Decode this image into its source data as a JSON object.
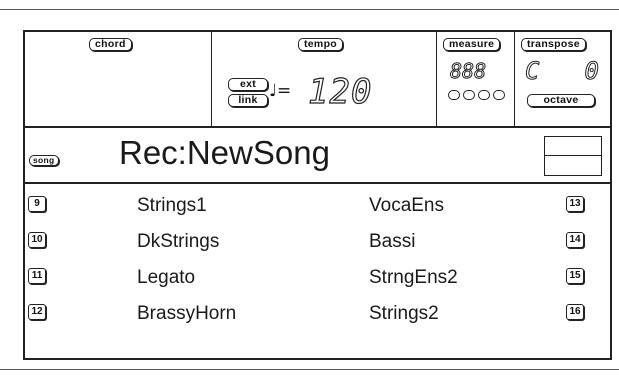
{
  "header": {
    "chord_label": "chord",
    "tempo_label": "tempo",
    "ext_label": "ext",
    "link_label": "link",
    "note_symbol": "♩=",
    "tempo_value": "120",
    "measure_label": "measure",
    "measure_value": "888",
    "transpose_label": "transpose",
    "transpose_left": "C",
    "transpose_right": "0",
    "octave_label": "octave"
  },
  "title": {
    "mode_label": "song",
    "text": "Rec:NewSong"
  },
  "tracks": [
    {
      "left_num": "9",
      "left_name": "Strings1",
      "right_name": "VocaEns",
      "right_num": "13"
    },
    {
      "left_num": "10",
      "left_name": "DkStrings",
      "right_name": "Bassi",
      "right_num": "14"
    },
    {
      "left_num": "11",
      "left_name": "Legato",
      "right_name": "StrngEns2",
      "right_num": "15"
    },
    {
      "left_num": "12",
      "left_name": "BrassyHorn",
      "right_name": "Strings2",
      "right_num": "16"
    }
  ]
}
